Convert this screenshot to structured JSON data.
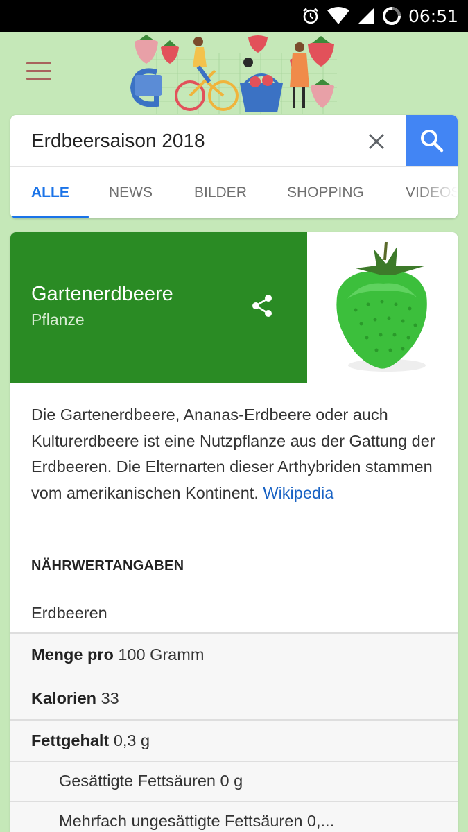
{
  "status_bar": {
    "time": "06:51",
    "icons": [
      "alarm-icon",
      "wifi-icon",
      "signal-icon",
      "battery-icon"
    ]
  },
  "header": {
    "menu_icon": "hamburger-menu-icon",
    "doodle": "strawberry-season-doodle"
  },
  "search": {
    "query": "Erdbeersaison 2018",
    "clear_icon": "close-icon",
    "search_icon": "search-icon",
    "accent": "#4285f4"
  },
  "tabs": [
    {
      "label": "ALLE",
      "active": true
    },
    {
      "label": "NEWS",
      "active": false
    },
    {
      "label": "BILDER",
      "active": false
    },
    {
      "label": "SHOPPING",
      "active": false
    },
    {
      "label": "VIDEOS",
      "active": false
    }
  ],
  "knowledge_panel": {
    "title": "Gartenerdbeere",
    "subtitle": "Pflanze",
    "header_color": "#2a8b24",
    "share_icon": "share-icon",
    "image": "green-strawberry-image",
    "description": "Die Gartenerdbeere, Ananas-Erdbeere oder auch Kulturerdbeere ist eine Nutzpflanze aus der Gattung der Erdbeeren. Die Elternarten dieser Arthybriden stammen vom amerikanischen Kontinent.",
    "source_link": "Wikipedia",
    "section_title": "NÄHRWERTANGABEN",
    "food": "Erdbeeren",
    "nutrition": {
      "serving_label": "Menge pro",
      "serving_value": "100 Gramm",
      "calories_label": "Kalorien",
      "calories_value": "33",
      "fat_label": "Fettgehalt",
      "fat_value": "0,3 g",
      "saturated": "Gesättigte Fettsäuren 0 g",
      "polyunsaturated": "Mehrfach ungesättigte Fettsäuren 0,..."
    }
  }
}
